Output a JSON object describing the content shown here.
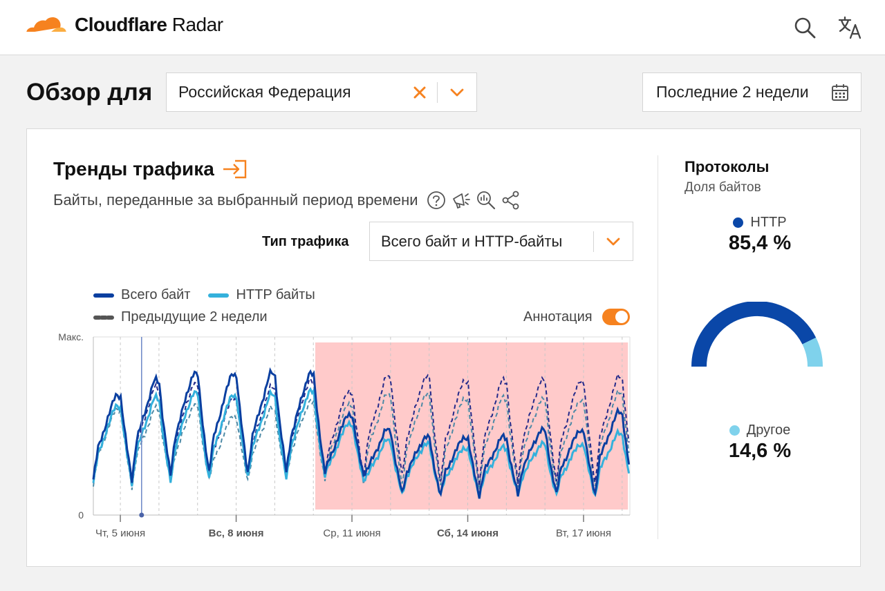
{
  "header": {
    "logo_word1": "Cloudflare",
    "logo_word2": "Radar",
    "icons": [
      "search-icon",
      "translate-icon"
    ]
  },
  "overview": {
    "title": "Обзор для",
    "country": "Российская Федерация",
    "period": "Последние 2 недели"
  },
  "traffic_trends": {
    "title": "Тренды трафика",
    "subtitle": "Байты, переданные за выбранный период времени",
    "traffic_type_label": "Тип трафика",
    "traffic_type_value": "Всего байт и HTTP-байты",
    "legend": {
      "total": "Всего байт",
      "http": "HTTP байты",
      "previous": "Предыдущие 2 недели"
    },
    "annotation_label": "Аннотация",
    "annotation_enabled": true
  },
  "protocols": {
    "title": "Протоколы",
    "subtitle": "Доля байтов",
    "http_label": "HTTP",
    "http_value": "85,4 %",
    "other_label": "Другое",
    "other_value": "14,6 %",
    "http_share": 0.854
  },
  "colors": {
    "accent": "#f6821f",
    "total_bytes": "#0a3fa0",
    "http_bytes": "#34b1dc",
    "total_bytes_previous": "#242a8a",
    "http_bytes_previous": "#4d8aa6",
    "annotation_shade": "#ffcaca",
    "gauge_http": "#0a47a8",
    "gauge_other": "#7fd2ec"
  },
  "chart_data": {
    "type": "line",
    "y_tick_labels": [
      "Макс.",
      "0"
    ],
    "ylim": [
      0,
      100
    ],
    "x_tick_labels": [
      {
        "label": "Чт, 5 июня",
        "day": 0.7,
        "bold": false
      },
      {
        "label": "Вс, 8 июня",
        "day": 3.7,
        "bold": true
      },
      {
        "label": "Ср, 11 июня",
        "day": 6.7,
        "bold": false
      },
      {
        "label": "Сб, 14 июня",
        "day": 9.7,
        "bold": true
      },
      {
        "label": "Вт, 17 июня",
        "day": 12.7,
        "bold": false
      }
    ],
    "x_range_days": [
      0,
      13.9
    ],
    "annotation_range_days": [
      5.75,
      13.85
    ],
    "marker_day": 1.25,
    "total_bytes": {
      "peaks": [
        68,
        76,
        80,
        80,
        80,
        80,
        57,
        48,
        44,
        44,
        44,
        48,
        48,
        58
      ],
      "troughs": [
        20,
        22,
        24,
        24,
        24,
        24,
        23,
        12,
        11,
        11,
        11,
        12,
        12,
        12
      ]
    },
    "http_bytes": {
      "peaks": [
        62,
        66,
        69,
        68,
        68,
        70,
        52,
        42,
        40,
        38,
        38,
        40,
        40,
        46
      ],
      "troughs": [
        18,
        18,
        20,
        22,
        20,
        22,
        20,
        11,
        11,
        11,
        11,
        11,
        11,
        11
      ]
    },
    "total_bytes_previous": {
      "peaks": [
        68,
        72,
        74,
        66,
        72,
        76,
        70,
        78,
        78,
        76,
        76,
        76,
        76,
        78
      ],
      "troughs": [
        18,
        20,
        22,
        22,
        22,
        22,
        22,
        22,
        18,
        18,
        18,
        18,
        18,
        20
      ]
    },
    "http_bytes_previous": {
      "peaks": [
        60,
        60,
        62,
        56,
        60,
        64,
        63,
        68,
        68,
        66,
        66,
        65,
        65,
        69
      ],
      "troughs": [
        16,
        18,
        20,
        20,
        20,
        20,
        18,
        16,
        16,
        16,
        16,
        16,
        16,
        16
      ]
    }
  }
}
